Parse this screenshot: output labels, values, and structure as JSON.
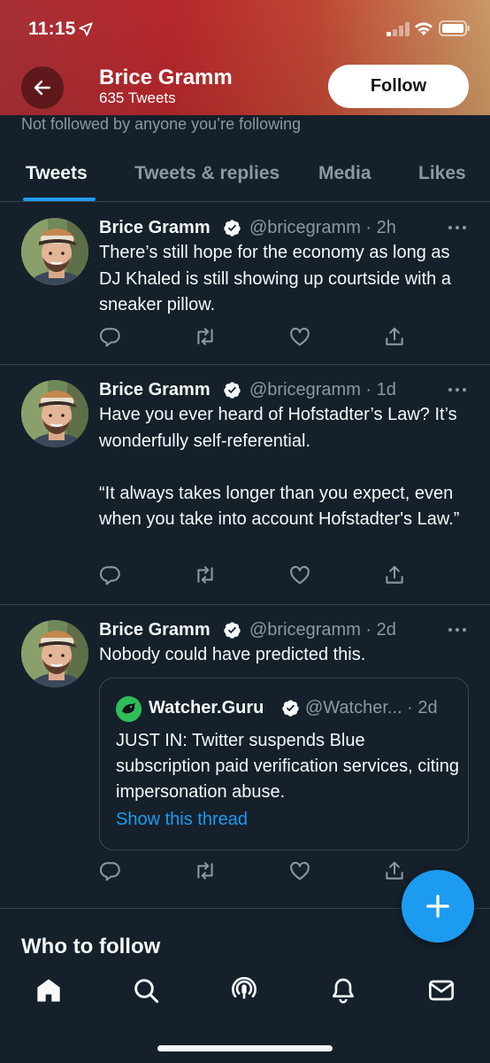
{
  "status_bar": {
    "time": "11:15"
  },
  "profile": {
    "name": "Brice Gramm",
    "tweet_count": "635 Tweets",
    "follow_label": "Follow",
    "not_followed_text": "Not followed by anyone you’re following"
  },
  "tabs": [
    {
      "label": "Tweets",
      "active": true
    },
    {
      "label": "Tweets & replies",
      "active": false
    },
    {
      "label": "Media",
      "active": false
    },
    {
      "label": "Likes",
      "active": false
    }
  ],
  "tweets": [
    {
      "name": "Brice Gramm",
      "handle_time": "@bricegramm · 2h",
      "text": "There’s still hope for the economy as long as DJ Khaled is still showing up courtside with a sneaker pillow."
    },
    {
      "name": "Brice Gramm",
      "handle_time": "@bricegramm · 1d",
      "text": "Have you ever heard of Hofstadter’s Law? It’s wonderfully self-referential.\n\n“It always takes longer than you expect, even when you take into account Hofstadter's Law.”"
    },
    {
      "name": "Brice Gramm",
      "handle_time": "@bricegramm · 2d",
      "text": "Nobody could have predicted this.",
      "quote": {
        "name": "Watcher.Guru",
        "handle_time": "@Watcher... · 2d",
        "text": "JUST IN: Twitter suspends Blue subscription paid verification services, citing impersonation abuse.",
        "link": "Show this thread"
      }
    }
  ],
  "who_to_follow": "Who to follow",
  "colors": {
    "background": "#15202b",
    "accent": "#1d9bf0",
    "secondary_text": "#8b98a5",
    "border": "#38444d"
  },
  "icons": {
    "nav": [
      "home-icon",
      "search-icon",
      "spaces-icon",
      "notifications-icon",
      "messages-icon"
    ],
    "actions": [
      "reply-icon",
      "retweet-icon",
      "like-icon",
      "share-icon"
    ]
  }
}
